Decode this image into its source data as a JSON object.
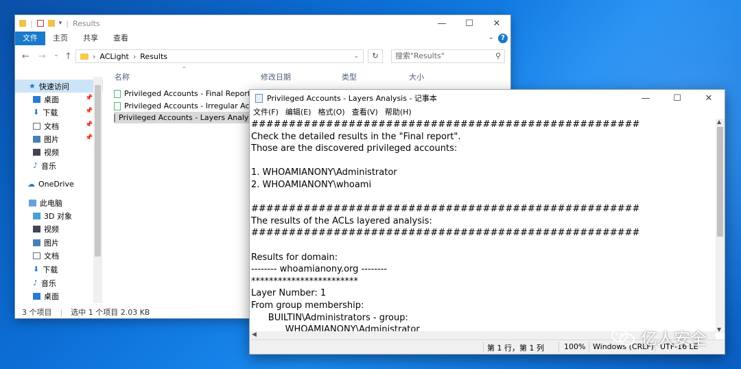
{
  "explorer": {
    "title": "Results",
    "ribbon_tabs": [
      "文件",
      "主页",
      "共享",
      "查看"
    ],
    "breadcrumb": [
      "ACLight",
      "Results"
    ],
    "search_placeholder": "搜索\"Results\"",
    "columns": [
      "名称",
      "修改日期",
      "类型",
      "大小"
    ],
    "nav": {
      "quick_access": "快速访问",
      "quick_items": [
        "桌面",
        "下载",
        "文档",
        "图片",
        "视频",
        "音乐"
      ],
      "onedrive": "OneDrive",
      "this_pc": "此电脑",
      "pc_items": [
        "3D 对象",
        "视频",
        "图片",
        "文档",
        "下载",
        "音乐",
        "桌面"
      ]
    },
    "files": [
      "Privileged Accounts - Final Report",
      "Privileged Accounts - Irregular Acco...",
      "Privileged Accounts - Layers Analysis"
    ],
    "status": {
      "count": "3 个项目",
      "selected": "选中 1 个项目  2.03 KB"
    }
  },
  "notepad": {
    "title": "Privileged Accounts - Layers Analysis - 记事本",
    "menu": [
      "文件(F)",
      "编辑(E)",
      "格式(O)",
      "查看(V)",
      "帮助(H)"
    ],
    "text": "####################################################\nCheck the detailed results in the \"Final report\".\nThose are the discovered privileged accounts:\n\n1. WHOAMIANONY\\Administrator\n2. WHOAMIANONY\\whoami\n\n####################################################\nThe results of the ACLs layered analysis:\n####################################################\n\nResults for domain:\n-------- whoamianony.org --------\n************************\nLayer Number: 1\nFrom group membership:\n      BUILTIN\\Administrators - group:\n            WHOAMIANONY\\Administrator",
    "status": {
      "position": "第 1 行，第 1 列",
      "zoom": "100%",
      "eol": "Windows (CRLF)",
      "encoding": "UTF-16 LE"
    }
  },
  "watermark": "亿人安全",
  "colors": {
    "accent": "#1979ca",
    "selection": "#cce4f7",
    "desktop": "#0c6fd6"
  }
}
